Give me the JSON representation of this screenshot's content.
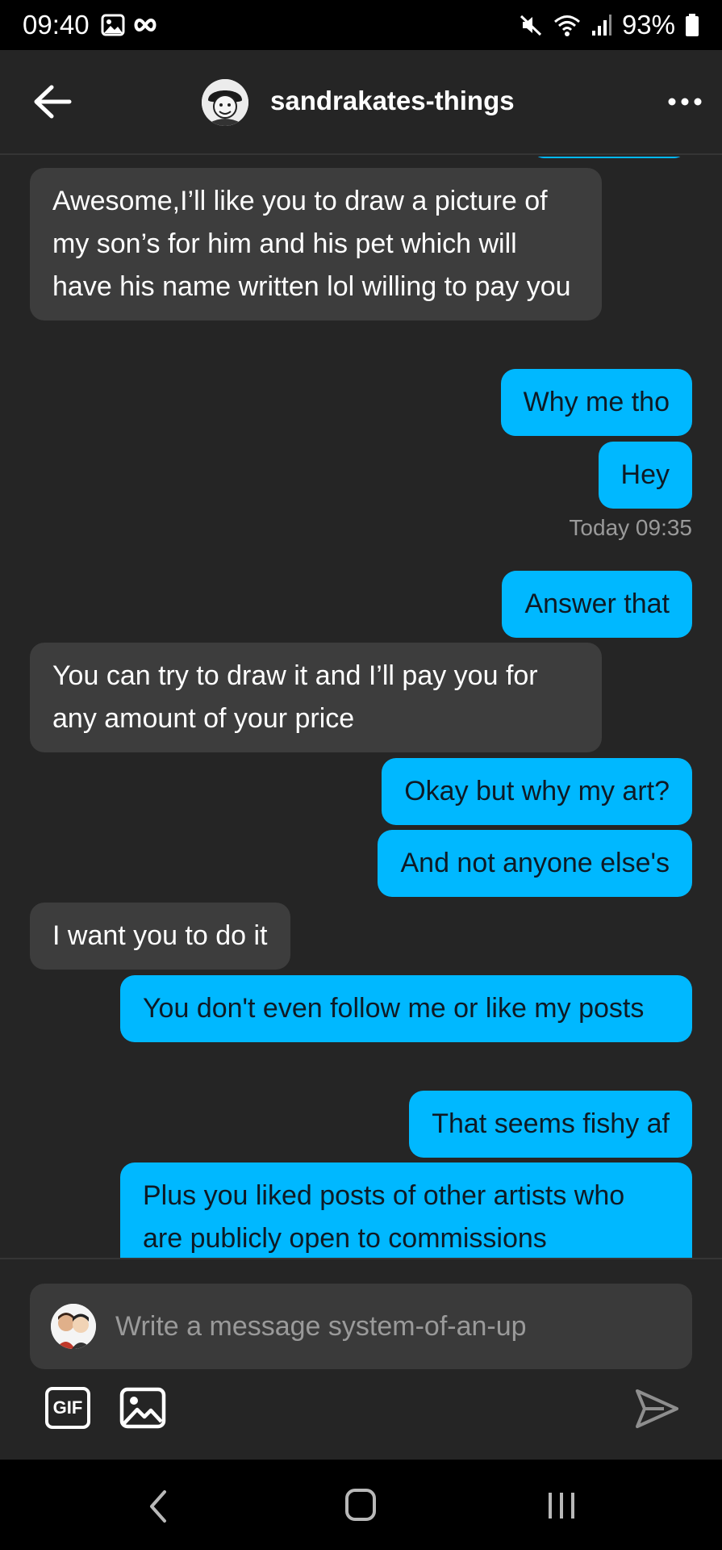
{
  "status_bar": {
    "time": "09:40",
    "battery": "93%"
  },
  "header": {
    "title": "sandrakates-things"
  },
  "messages": [
    {
      "side": "in",
      "text": "Awesome,I’ll like you to draw a picture of my son’s for him and his pet which will have his name written lol willing to pay you"
    },
    {
      "side": "out",
      "text": "Why me tho"
    },
    {
      "side": "out",
      "text": "Hey"
    },
    {
      "side": "meta",
      "text": "Today 09:35"
    },
    {
      "side": "out",
      "text": "Answer that"
    },
    {
      "side": "in",
      "text": "You can try to draw it and I’ll pay you for any amount of your price"
    },
    {
      "side": "out",
      "text": "Okay but why my art?"
    },
    {
      "side": "out",
      "text": "And not anyone else's"
    },
    {
      "side": "in",
      "text": "I want you to do it"
    },
    {
      "side": "out",
      "text": "You don't even follow me or like my posts"
    },
    {
      "side": "out",
      "text": "That seems fishy af"
    },
    {
      "side": "out",
      "text": "Plus you liked posts of other artists who are publicly open to commissions"
    }
  ],
  "composer": {
    "placeholder": "Write a message system-of-an-up",
    "gif_label": "GIF"
  },
  "colors": {
    "background": "#252525",
    "incoming_bubble": "#3d3d3d",
    "outgoing_bubble": "#00b8ff"
  },
  "icons": [
    "back-arrow-icon",
    "more-icon",
    "gallery-icon",
    "infinity-icon",
    "mute-icon",
    "wifi-icon",
    "signal-icon",
    "battery-icon",
    "image-icon",
    "send-icon",
    "nav-back-icon",
    "nav-home-icon",
    "nav-recents-icon"
  ]
}
